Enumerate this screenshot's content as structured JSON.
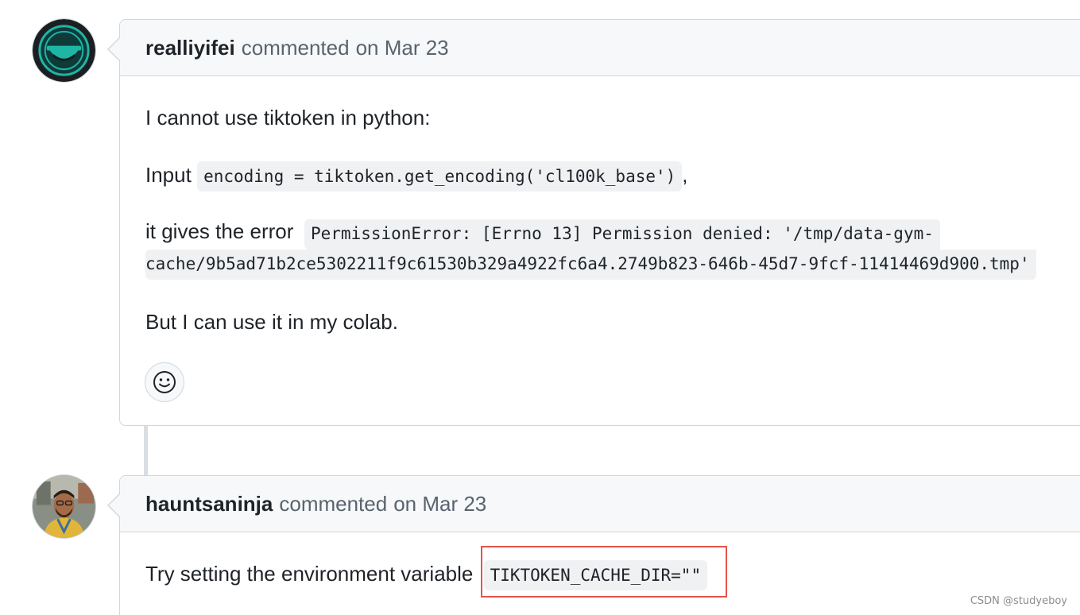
{
  "comments": [
    {
      "author": "realliyifei",
      "action": "commented",
      "date": "on Mar 23",
      "line1": "I cannot use tiktoken in python:",
      "line2_prefix": "Input",
      "line2_code": "encoding = tiktoken.get_encoding('cl100k_base')",
      "line2_suffix": ",",
      "line3_prefix": "it gives the error",
      "line3_code_a": "PermissionError: [Errno 13] Permission denied: '/tmp/data-gym-",
      "line3_code_b": "cache/9b5ad71b2ce5302211f9c61530b329a4922fc6a4.2749b823-646b-45d7-9fcf-11414469d900.tmp'",
      "line4": "But I can use it in my colab.",
      "reaction_icon": "smiley-icon"
    },
    {
      "author": "hauntsaninja",
      "action": "commented",
      "date": "on Mar 23",
      "line1_prefix": "Try setting the environment variable",
      "line1_code": "TIKTOKEN_CACHE_DIR=\"\""
    }
  ],
  "watermark": "CSDN @studyeboy",
  "colors": {
    "highlight": "#e5534b",
    "header_bg": "#f6f8fa",
    "border": "#d0d7de"
  }
}
